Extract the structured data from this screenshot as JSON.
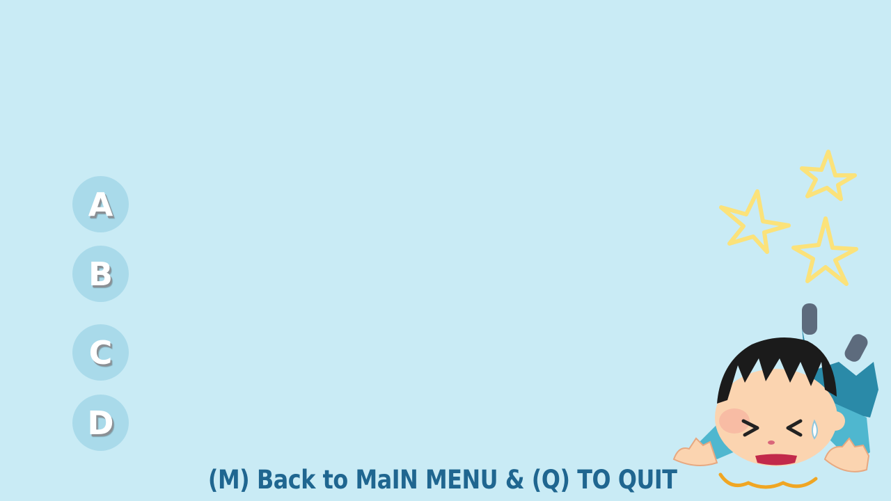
{
  "answers": {
    "options": [
      {
        "letter": "A"
      },
      {
        "letter": "B"
      },
      {
        "letter": "C"
      },
      {
        "letter": "D"
      }
    ]
  },
  "footer": {
    "text": "(M) Back to MaIN MENU & (Q) TO QUIT"
  },
  "colors": {
    "background": "#c9ebf5",
    "option_circle": "#a9daea",
    "footer_text": "#1f6690",
    "stars": "#fbe27a"
  },
  "illustration": {
    "icon": "fallen-boy-with-dizzy-stars-icon"
  }
}
